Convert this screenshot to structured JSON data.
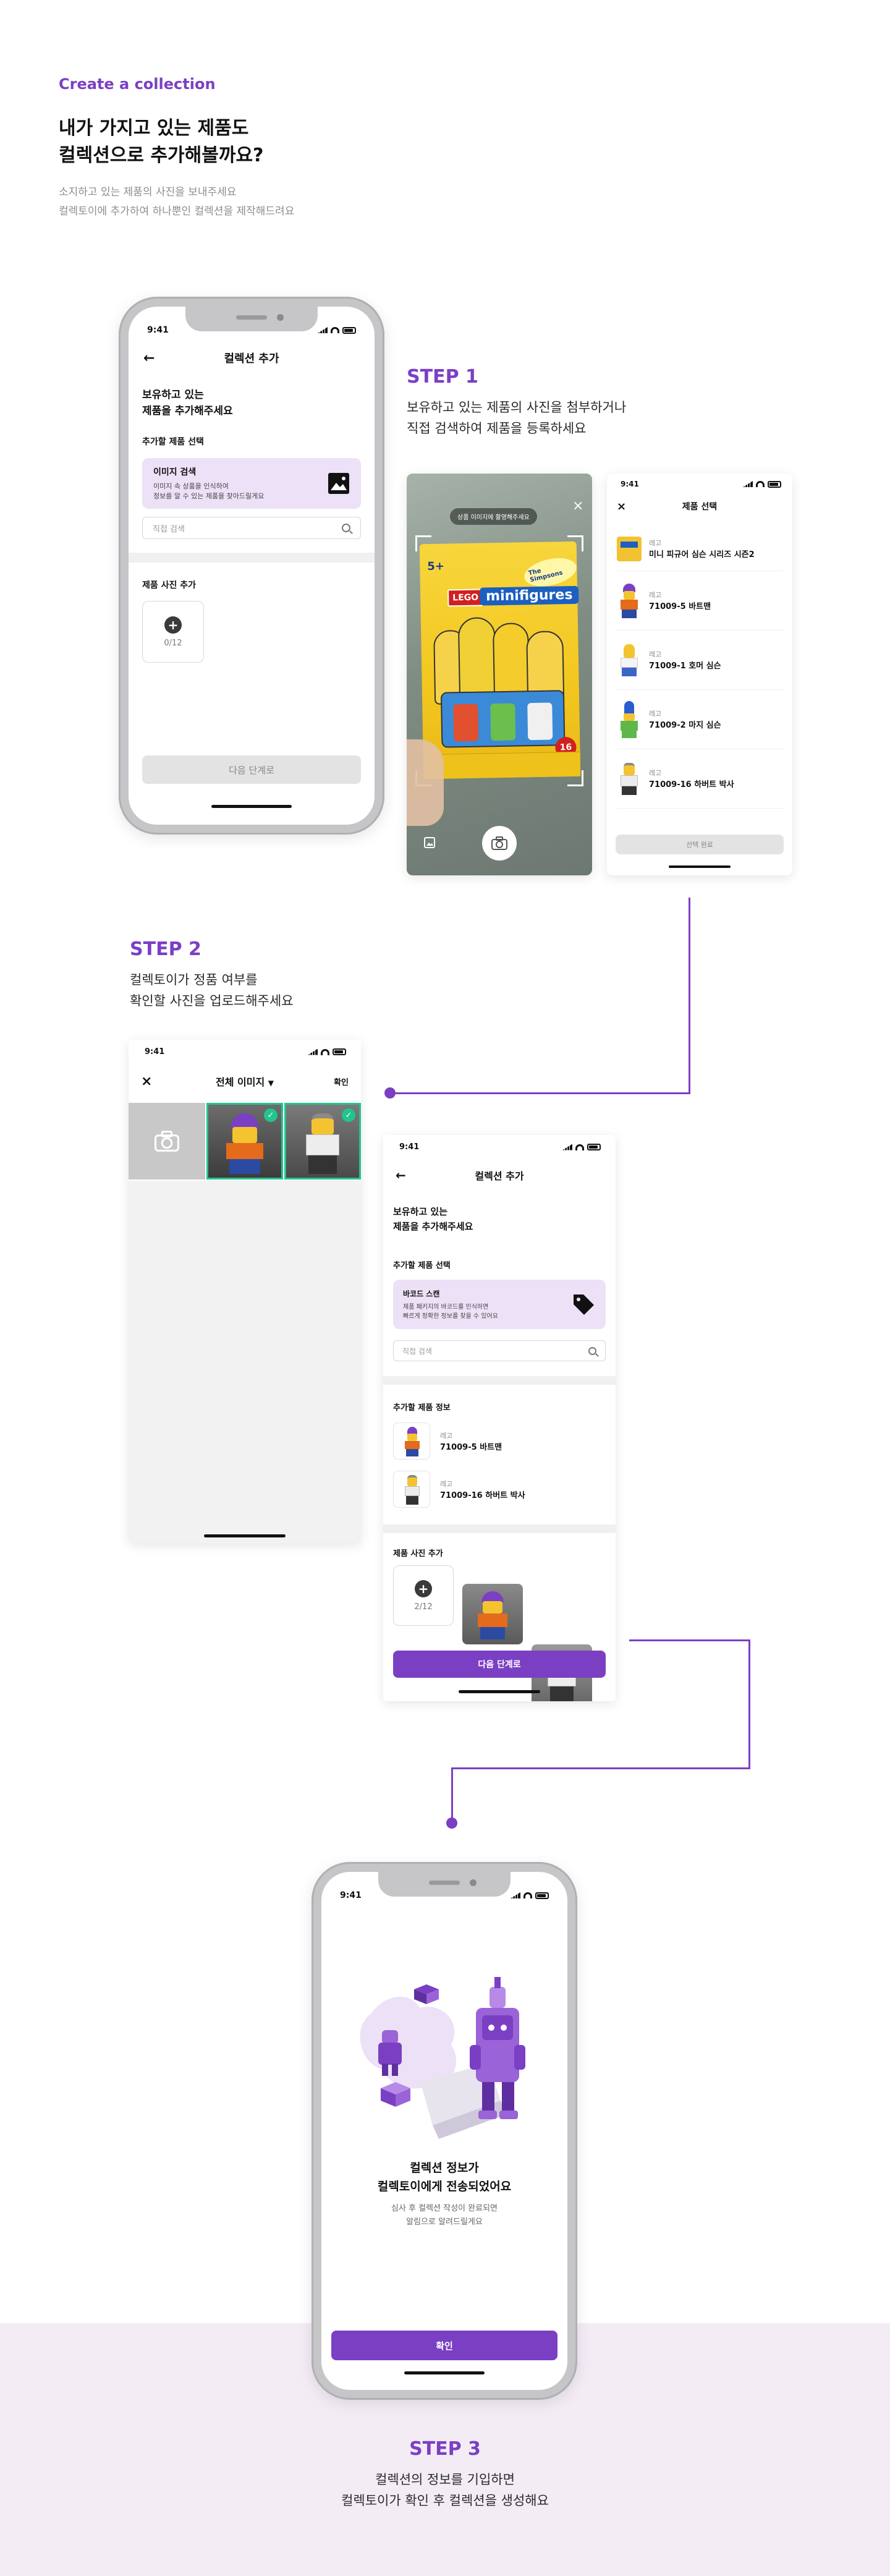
{
  "header": {
    "eyebrow": "Create a collection",
    "title": "내가 가지고 있는 제품도\n컬렉션으로 추가해볼까요?",
    "subtitle": "소지하고 있는 제품의 사진을 보내주세요\n컬렉토이에 추가하여 하나뿐인 컬렉션을 제작해드려요"
  },
  "colors": {
    "accent": "#7b3fc4",
    "feature_bg": "#ece1f6",
    "band": "#f3ecf5",
    "check": "#22c58b"
  },
  "status_time": "9:41",
  "step1": {
    "title": "STEP 1",
    "desc": "보유하고 있는 제품의 사진을 첨부하거나\n직접 검색하여 제품을 등록하세요"
  },
  "step2": {
    "title": "STEP 2",
    "desc": "컬렉토이가 정품 여부를\n확인할 사진을 업로드해주세요"
  },
  "step3": {
    "title": "STEP 3",
    "desc": "컬렉션의 정보를 기입하면\n컬렉토이가 확인 후 컬렉션을 생성해요"
  },
  "screen_add": {
    "back_icon": "arrow-left-icon",
    "title": "컬렉션 추가",
    "prompt": "보유하고 있는\n제품을 추가해주세요",
    "select_label": "추가할 제품 선택",
    "image_search_title": "이미지 검색",
    "image_search_desc": "이미지 속 상품을 인식하여\n정보를 알 수 있는 제품을 찾아드릴게요",
    "search_placeholder": "직접 검색",
    "photo_label": "제품 사진 추가",
    "photo_count": "0/12",
    "next_button": "다음 단계로"
  },
  "camera": {
    "hint": "상품 이미지에 촬영해주세요",
    "close_icon": "close-icon",
    "box_brand": "LEGO",
    "box_name": "minifigures",
    "box_badge": "5+",
    "box_series": "The Simpsons"
  },
  "select_product": {
    "title": "제품 선택",
    "items": [
      {
        "brand": "레고",
        "name": "미니 피규어 심슨 시리즈 시즌2"
      },
      {
        "brand": "레고",
        "name": "71009-5 바트맨"
      },
      {
        "brand": "레고",
        "name": "71009-1 호머 심슨"
      },
      {
        "brand": "레고",
        "name": "71009-2 마지 심슨"
      },
      {
        "brand": "레고",
        "name": "71009-16 하버트 박사"
      }
    ],
    "confirm": "선택 완료"
  },
  "gallery": {
    "title": "전체 이미지",
    "confirm": "확인"
  },
  "screen_add2": {
    "title": "컬렉션 추가",
    "prompt": "보유하고 있는\n제품을 추가해주세요",
    "select_label": "추가할 제품 선택",
    "barcode_title": "바코드 스캔",
    "barcode_desc": "제품 패키지의 바코드를 인식하면\n빠르게 정확한 정보를 찾을 수 있어요",
    "search_placeholder": "직접 검색",
    "info_label": "추가할 제품 정보",
    "items": [
      {
        "brand": "레고",
        "name": "71009-5 바트맨"
      },
      {
        "brand": "레고",
        "name": "71009-16 하버트 박사"
      }
    ],
    "photo_label": "제품 사진 추가",
    "photo_count": "2/12",
    "next_button": "다음 단계로"
  },
  "done": {
    "title": "컬렉션 정보가\n컬렉토이에게 전송되었어요",
    "desc": "심사 후 컬렉션 작성이 완료되면\n알림으로 알려드릴게요",
    "confirm": "확인"
  }
}
